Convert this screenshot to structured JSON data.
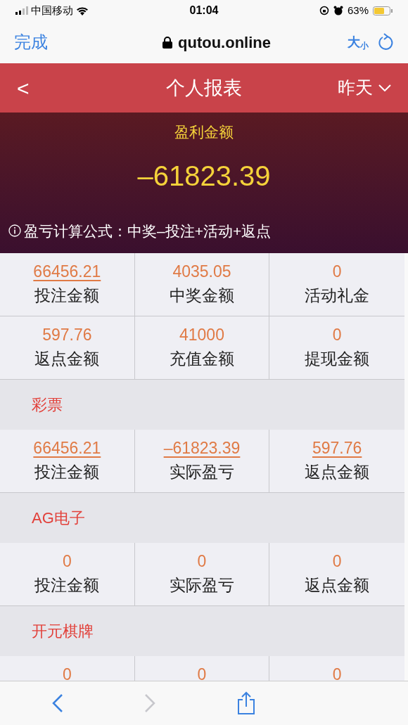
{
  "status_bar": {
    "carrier": "中国移动",
    "time": "01:04",
    "battery": "63%"
  },
  "browser": {
    "done": "完成",
    "url": "qutou.online",
    "text_size": "大",
    "text_size_small": "小"
  },
  "header": {
    "back": "<",
    "title": "个人报表",
    "period": "昨天"
  },
  "summary": {
    "label": "盈利金额",
    "amount": "–61823.39",
    "formula": "盈亏计算公式：中奖–投注+活动+返点"
  },
  "overview": [
    {
      "value": "66456.21",
      "label": "投注金额",
      "link": true
    },
    {
      "value": "4035.05",
      "label": "中奖金额",
      "link": false
    },
    {
      "value": "0",
      "label": "活动礼金",
      "link": false
    },
    {
      "value": "597.76",
      "label": "返点金额",
      "link": false
    },
    {
      "value": "41000",
      "label": "充值金额",
      "link": false
    },
    {
      "value": "0",
      "label": "提现金额",
      "link": false
    }
  ],
  "sections": [
    {
      "title": "彩票",
      "cells": [
        {
          "value": "66456.21",
          "label": "投注金额",
          "link": true
        },
        {
          "value": "–61823.39",
          "label": "实际盈亏",
          "link": true
        },
        {
          "value": "597.76",
          "label": "返点金额",
          "link": true
        }
      ]
    },
    {
      "title": "AG电子",
      "cells": [
        {
          "value": "0",
          "label": "投注金额",
          "link": false
        },
        {
          "value": "0",
          "label": "实际盈亏",
          "link": false
        },
        {
          "value": "0",
          "label": "返点金额",
          "link": false
        }
      ]
    },
    {
      "title": "开元棋牌",
      "cells": [
        {
          "value": "0"
        },
        {
          "value": "0"
        },
        {
          "value": "0"
        }
      ]
    }
  ],
  "toolbar": {
    "back_enabled": true,
    "forward_enabled": false
  }
}
